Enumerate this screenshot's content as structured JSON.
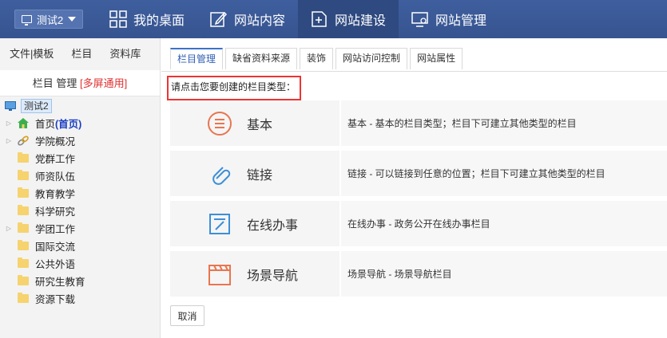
{
  "topbar": {
    "site_switch": "测试2",
    "navs": [
      {
        "label": "我的桌面",
        "icon": "grid-icon",
        "active": false
      },
      {
        "label": "网站内容",
        "icon": "edit-icon",
        "active": false
      },
      {
        "label": "网站建设",
        "icon": "add-page-icon",
        "active": true
      },
      {
        "label": "网站管理",
        "icon": "monitor-gear-icon",
        "active": false
      }
    ]
  },
  "left": {
    "tabs": [
      "文件|模板",
      "栏目",
      "资料库"
    ],
    "title_main": "栏目 管理",
    "title_tag": "[多屏通用]",
    "root": "测试2",
    "items": [
      {
        "label": "首页",
        "suffix": "(首页)",
        "expand": true,
        "icon": "home-icon"
      },
      {
        "label": "学院概况",
        "expand": true,
        "icon": "link-icon"
      },
      {
        "label": "党群工作",
        "expand": false,
        "icon": "folder-icon"
      },
      {
        "label": "师资队伍",
        "expand": false,
        "icon": "folder-icon"
      },
      {
        "label": "教育教学",
        "expand": false,
        "icon": "folder-icon"
      },
      {
        "label": "科学研究",
        "expand": false,
        "icon": "folder-icon"
      },
      {
        "label": "学团工作",
        "expand": true,
        "icon": "folder-icon"
      },
      {
        "label": "国际交流",
        "expand": false,
        "icon": "folder-icon"
      },
      {
        "label": "公共外语",
        "expand": false,
        "icon": "folder-icon"
      },
      {
        "label": "研究生教育",
        "expand": false,
        "icon": "folder-icon"
      },
      {
        "label": "资源下载",
        "expand": false,
        "icon": "folder-icon"
      }
    ]
  },
  "main": {
    "tabs": [
      "栏目管理",
      "缺省资料来源",
      "装饰",
      "网站访问控制",
      "网站属性"
    ],
    "prompt": "请点击您要创建的栏目类型：",
    "types": [
      {
        "name": "基本",
        "icon": "list-circle-icon",
        "desc": "基本 - 基本的栏目类型；栏目下可建立其他类型的栏目"
      },
      {
        "name": "链接",
        "icon": "paperclip-icon",
        "desc": "链接 - 可以链接到任意的位置；栏目下可建立其他类型的栏目"
      },
      {
        "name": "在线办事",
        "icon": "form-pen-icon",
        "desc": "在线办事 - 政务公开在线办事栏目"
      },
      {
        "name": "场景导航",
        "icon": "clapper-icon",
        "desc": "场景导航 - 场景导航栏目"
      }
    ],
    "cancel": "取消"
  },
  "colors": {
    "topbar": "#3b5998",
    "active_nav": "#2f4a80",
    "accent": "#e9754f",
    "link_blue": "#3d8fd8",
    "highlight_red": "#e33333"
  }
}
